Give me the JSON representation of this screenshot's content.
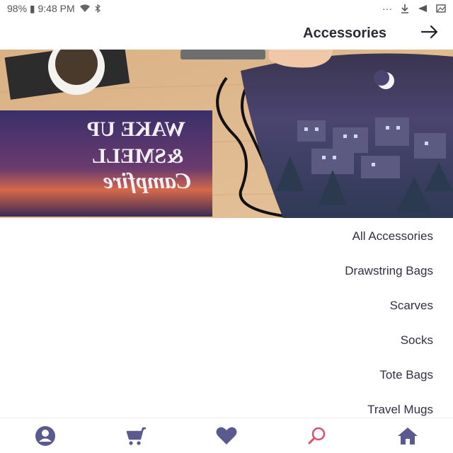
{
  "status_bar": {
    "time_battery": "98% ▮ 9:48 PM",
    "right_dots": "···"
  },
  "header": {
    "title": "Accessories",
    "back_icon": "arrow-right-icon"
  },
  "hero": {
    "pouch_text": "WAKE UP & SMELL the Campfire"
  },
  "categories": [
    {
      "label": "All Accessories"
    },
    {
      "label": "Drawstring Bags"
    },
    {
      "label": "Scarves"
    },
    {
      "label": "Socks"
    },
    {
      "label": "Tote Bags"
    },
    {
      "label": "Travel Mugs"
    }
  ],
  "bottom_nav": [
    {
      "icon": "profile-icon",
      "active": false
    },
    {
      "icon": "cart-icon",
      "active": false
    },
    {
      "icon": "heart-icon",
      "active": false
    },
    {
      "icon": "search-icon",
      "active": true
    },
    {
      "icon": "home-icon",
      "active": false
    }
  ],
  "colors": {
    "nav_icon": "#5b5a8e",
    "nav_active": "#d9506a",
    "text": "#2f2f45"
  }
}
